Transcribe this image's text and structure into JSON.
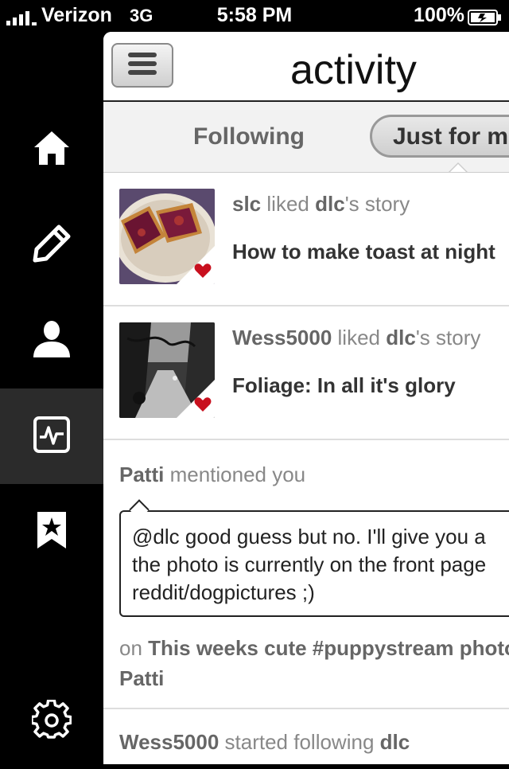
{
  "status_bar": {
    "carrier": "Verizon",
    "network": "3G",
    "time": "5:58 PM",
    "battery": "100%"
  },
  "sidebar": {
    "items": [
      {
        "icon": "home-icon"
      },
      {
        "icon": "pencil-icon"
      },
      {
        "icon": "profile-icon"
      },
      {
        "icon": "activity-icon",
        "active": true
      },
      {
        "icon": "bookmark-star-icon"
      },
      {
        "icon": "gear-icon"
      }
    ]
  },
  "header": {
    "title": "activity"
  },
  "tabs": {
    "following": "Following",
    "just_for_me": "Just for me",
    "selected": "Just for me"
  },
  "feed": {
    "likes": [
      {
        "user": "slc",
        "action": "liked",
        "owner": "dlc",
        "suffix": "'s story",
        "title": "How to make toast at night"
      },
      {
        "user": "Wess5000",
        "action": "liked",
        "owner": "dlc",
        "suffix": "'s story",
        "title": "Foliage: In all it's glory"
      }
    ],
    "mention": {
      "user": "Patti",
      "action": "mentioned you",
      "handle": "@dlc",
      "line1": " good guess but no. I'll give you a",
      "line2": "the photo is currently on the front page",
      "line3": "reddit/dogpictures ;)",
      "on_prefix": "on",
      "on_story": "This weeks cute #puppystream photo",
      "author": "Patti"
    },
    "follow": {
      "user": "Wess5000",
      "action": "started following",
      "target": "dlc"
    }
  }
}
